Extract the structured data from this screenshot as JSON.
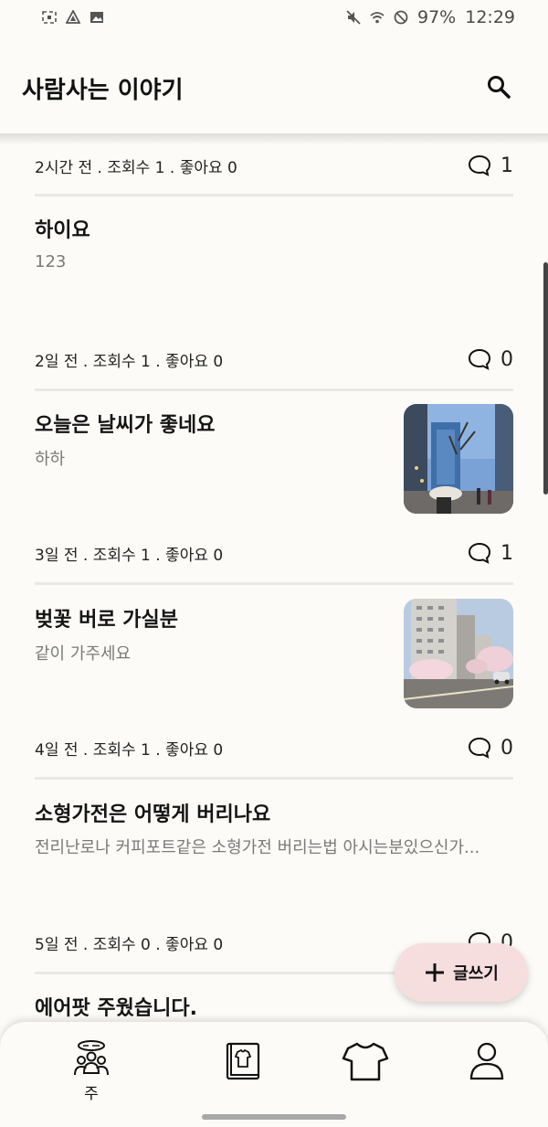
{
  "status_bar": {
    "battery": "97%",
    "time": "12:29"
  },
  "app_bar": {
    "title": "사람사는 이야기"
  },
  "posts": [
    {
      "meta": "2시간 전 . 조회수 1 . 좋아요 0",
      "comments": "1"
    },
    {
      "title": "하이요",
      "body": "123",
      "meta": "2일 전 . 조회수 1 . 좋아요 0",
      "comments": "0"
    },
    {
      "title": "오늘은 날씨가 좋네요",
      "body": "하하",
      "meta": "3일 전 . 조회수 1 . 좋아요 0",
      "comments": "1"
    },
    {
      "title": "벚꽃 버로 가실분",
      "body": "같이 가주세요",
      "meta": "4일 전 . 조회수 1 . 좋아요 0",
      "comments": "0"
    },
    {
      "title": "소형가전은 어떻게 버리나요",
      "body": "전리난로나 커피포트같은 소형가전 버리는법 아시는분있으신가...",
      "meta": "5일 전 . 조회수 0 . 좋아요 0",
      "comments": "0"
    },
    {
      "title": "에어팟 주웠습니다."
    }
  ],
  "fab": {
    "label": "글쓰기"
  },
  "bottom_nav": {
    "home_label": "주"
  }
}
